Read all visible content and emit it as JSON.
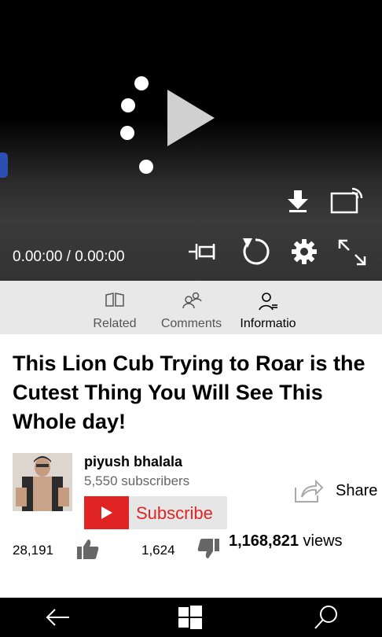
{
  "player": {
    "time_display": "0.00:00 / 0.00:00",
    "icons": [
      "loading-spinner-icon",
      "play-icon",
      "download-icon",
      "cast-icon",
      "pin-icon",
      "replay-icon",
      "settings-icon",
      "fullscreen-icon"
    ]
  },
  "tabs": [
    {
      "label": "Related",
      "icon": "related-icon"
    },
    {
      "label": "Comments",
      "icon": "comments-icon"
    },
    {
      "label": "Informatio",
      "icon": "person-icon",
      "active": true
    }
  ],
  "video": {
    "title": "This Lion Cub Trying to Roar is the Cutest Thing You Will See This Whole day!",
    "channel": "piyush bhalala",
    "subscribers": "5,550 subscribers",
    "subscribe_label": "Subscribe",
    "share_label": "Share",
    "likes": "28,191",
    "dislikes": "1,624",
    "views_count": "1,168,821",
    "views_label": "views"
  },
  "colors": {
    "accent_red": "#e02424",
    "scrub_blue": "#2b4fb3"
  },
  "navbar": {
    "icons": [
      "back-icon",
      "windows-start-icon",
      "search-icon"
    ]
  }
}
